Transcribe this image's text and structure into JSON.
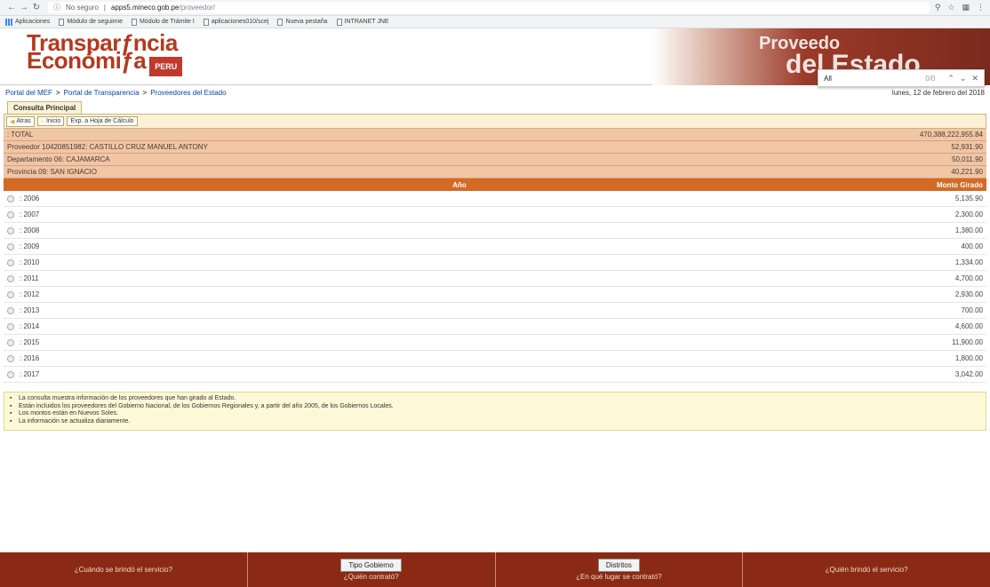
{
  "browser": {
    "security": "No seguro",
    "host": "apps5.mineco.gob.pe",
    "path": "/proveedor/",
    "bookmarks": [
      "Aplicaciones",
      "Módulo de seguimie",
      "Módulo de Trámite I",
      "aplicaciones010/scej",
      "Nueva pestaña",
      "INTRANET JNE"
    ]
  },
  "find": {
    "query": "All",
    "count": "0/0"
  },
  "header": {
    "logo_line1": "Transparƒncia",
    "logo_line2": "Económiƒa",
    "logo_badge": "PERU",
    "hero_line1": "Proveedo",
    "hero_line2": "del Estado"
  },
  "breadcrumb": [
    "Portal del MEF",
    "Portal de Transparencia",
    "Proveedores del Estado"
  ],
  "date": "lunes, 12 de febrero del 2018",
  "tab": "Consulta Principal",
  "toolbar": {
    "back": "Atras",
    "home": "Inicio",
    "export": "Exp. a Hoja de Cálculo"
  },
  "summary": [
    {
      "label": ": TOTAL",
      "value": "470,388,222,955.84"
    },
    {
      "label": "Proveedor 10420851982: CASTILLO CRUZ MANUEL ANTONY",
      "value": "52,931.90"
    },
    {
      "label": "Departamento 06: CAJAMARCA",
      "value": "50,011.90"
    },
    {
      "label": "Provincia 09: SAN IGNACIO",
      "value": "40,221.90"
    }
  ],
  "columns": {
    "year": "Año",
    "amount": "Monto Girado"
  },
  "rows": [
    {
      "year": ": 2006",
      "amount": "5,135.90"
    },
    {
      "year": ": 2007",
      "amount": "2,300.00"
    },
    {
      "year": ": 2008",
      "amount": "1,380.00"
    },
    {
      "year": ": 2009",
      "amount": "400.00"
    },
    {
      "year": ": 2010",
      "amount": "1,334.00"
    },
    {
      "year": ": 2011",
      "amount": "4,700.00"
    },
    {
      "year": ": 2012",
      "amount": "2,930.00"
    },
    {
      "year": ": 2013",
      "amount": "700.00"
    },
    {
      "year": ": 2014",
      "amount": "4,600.00"
    },
    {
      "year": ": 2015",
      "amount": "11,900.00"
    },
    {
      "year": ": 2016",
      "amount": "1,800.00"
    },
    {
      "year": ": 2017",
      "amount": "3,042.00"
    }
  ],
  "notes": [
    "La consulta muestra información de los proveedores que han girado al Estado.",
    "Están incluidos los proveedores del Gobierno Nacional, de los Gobiernos Regionales y, a partir del año 2005, de los Gobiernos Locales.",
    "Los montos están en Nuevos Soles.",
    "La información se actualiza diariamente."
  ],
  "footer": [
    {
      "button": "",
      "text": "¿Cuándo se brindó el servicio?"
    },
    {
      "button": "Tipo Gobierno",
      "text": "¿Quién contrató?"
    },
    {
      "button": "Distritos",
      "text": "¿En qué lugar se contrató?"
    },
    {
      "button": "",
      "text": "¿Quién brindó el servicio?"
    }
  ]
}
